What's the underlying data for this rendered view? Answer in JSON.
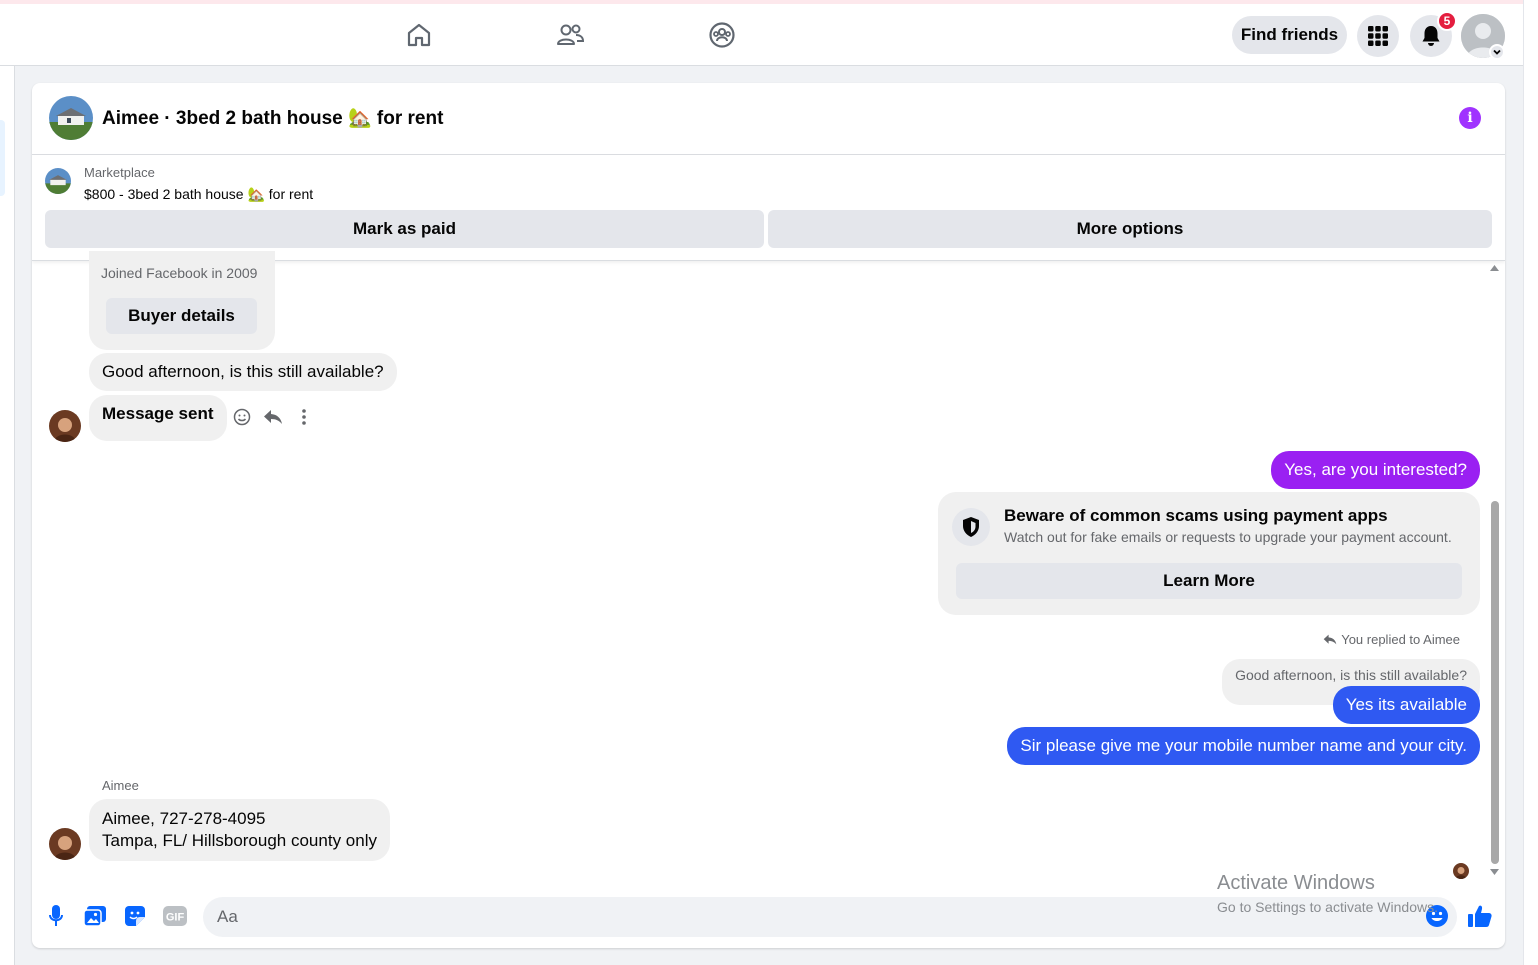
{
  "topbar": {
    "nav": [
      {
        "name": "home-icon"
      },
      {
        "name": "friends-icon"
      },
      {
        "name": "groups-icon"
      }
    ],
    "find_friends_label": "Find friends",
    "notifications_count": "5"
  },
  "chat": {
    "title": "Aimee · 3bed 2 bath house 🏡 for rent",
    "listing": {
      "category": "Marketplace",
      "title": "$800 - 3bed 2 bath house 🏡 for rent",
      "mark_paid_label": "Mark as paid",
      "more_options_label": "More options"
    },
    "messages": {
      "joined_text": "Joined Facebook in 2009",
      "buyer_details_label": "Buyer details",
      "msg1": "Good afternoon, is this still available?",
      "msg2": "Message sent",
      "out1": "Yes, are you interested?",
      "scam_title": "Beware of common scams using payment apps",
      "scam_sub": "Watch out for fake emails or requests to upgrade your payment account.",
      "learn_more_label": "Learn More",
      "replied_label": "You replied to Aimee",
      "quoted": "Good afternoon, is this still available?",
      "out2": "Yes its available",
      "out3": "Sir please give me your mobile number name and your city.",
      "sender_name": "Aimee",
      "in_last_line1": "Aimee, 727-278-4095",
      "in_last_line2": "Tampa, FL/ Hillsborough county only"
    },
    "composer": {
      "placeholder": "Aa"
    }
  },
  "watermark": {
    "title": "Activate Windows",
    "subtitle": "Go to Settings to activate Windows."
  },
  "colors": {
    "purple_bubble": "#9a20f2",
    "blue_bubble": "#2f59f2",
    "accent": "#0866ff"
  }
}
